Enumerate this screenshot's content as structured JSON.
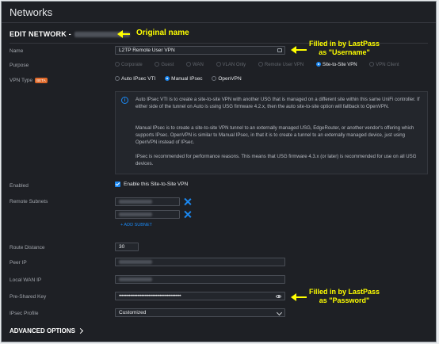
{
  "page": {
    "title": "Networks",
    "edit_heading": "EDIT NETWORK -"
  },
  "fields": {
    "name_label": "Name",
    "name_value": "L2TP Remote User VPN",
    "purpose_label": "Purpose",
    "purpose_options": [
      "Corporate",
      "Guest",
      "WAN",
      "VLAN Only",
      "Remote User VPN",
      "Site-to-Site VPN",
      "VPN Client"
    ],
    "purpose_selected": "Site-to-Site VPN",
    "vpn_type_label": "VPN Type",
    "vpn_type_badge": "BETA",
    "vpn_type_options": [
      "Auto IPsec VTI",
      "Manual IPsec",
      "OpenVPN"
    ],
    "vpn_type_selected": "Manual IPsec",
    "enabled_label": "Enabled",
    "enabled_text": "Enable this Site-to-Site VPN",
    "remote_subnets_label": "Remote Subnets",
    "add_subnet": "+ ADD SUBNET",
    "route_distance_label": "Route Distance",
    "route_distance_value": "30",
    "peer_ip_label": "Peer IP",
    "local_wan_ip_label": "Local WAN IP",
    "psk_label": "Pre-Shared Key",
    "psk_value": "••••••••••••••••••••••••••••••••••••••••••••",
    "ipsec_profile_label": "IPsec Profile",
    "ipsec_profile_value": "Customized"
  },
  "info": {
    "p1": "Auto IPsec VTI is to create a site-to-site VPN with another USG that is managed on a different site within this same UniFi controller. If either side of the tunnel on Auto is using USG firmware 4.2.x, then the auto site-to-site option will fallback to OpenVPN.",
    "p2": "Manual IPsec is to create a site-to-site VPN tunnel to an externally managed USG, EdgeRouter, or another vendor's offering which supports IPsec. OpenVPN is similar to Manual IPsec, in that it is to create a tunnel to an externally managed device, just using OpenVPN instead of IPsec.",
    "p3": "IPsec is recommended for performance reasons. This means that USG firmware 4.3.x (or later) is recommended for use on all USG devices."
  },
  "advanced": "ADVANCED OPTIONS",
  "callouts": {
    "original": "Original name",
    "username": "Filled in by LastPass\nas \"Username\"",
    "password": "Filled in by LastPass\nas \"Password\""
  },
  "colors": {
    "accent": "#1b88f2",
    "callout": "#ffff00",
    "background": "#1e2025"
  },
  "icons": [
    "info-icon",
    "key-icon",
    "close-icon",
    "eye-icon",
    "chevron-down-icon",
    "chevron-right-icon"
  ]
}
